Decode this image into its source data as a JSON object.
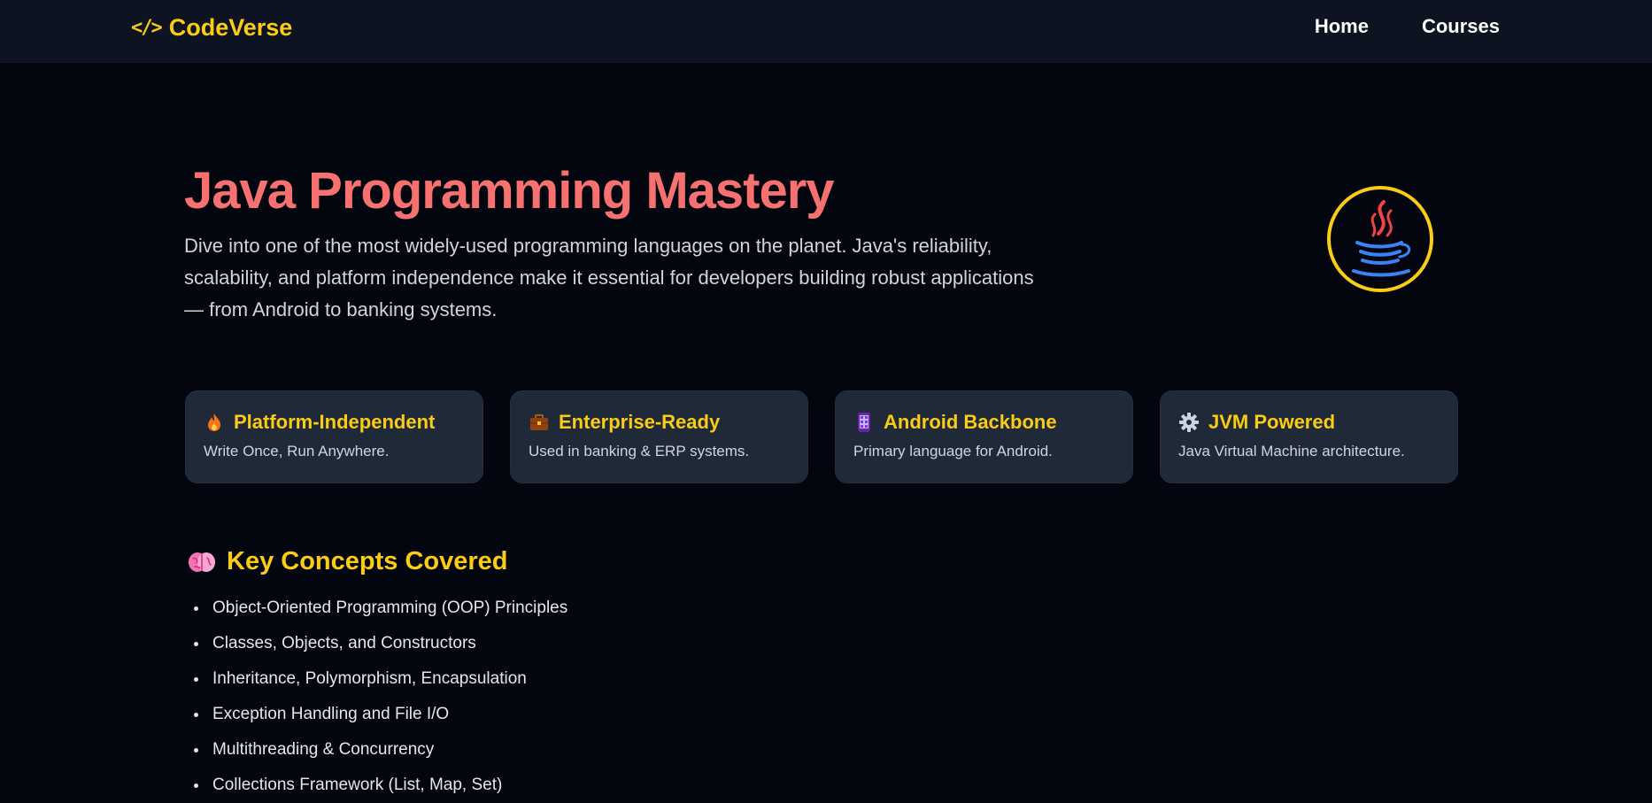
{
  "navbar": {
    "brand_icon": "</>",
    "brand_name": "CodeVerse",
    "links": [
      {
        "label": "Home"
      },
      {
        "label": "Courses"
      }
    ]
  },
  "hero": {
    "title": "Java Programming Mastery",
    "description": "Dive into one of the most widely-used programming languages on the planet. Java's reliability, scalability, and platform independence make it essential for developers building robust applications — from Android to banking systems.",
    "logo_icon": "java-coffee-cup-icon"
  },
  "features": [
    {
      "icon": "fire-icon",
      "title": "Platform-Independent",
      "description": "Write Once, Run Anywhere."
    },
    {
      "icon": "briefcase-icon",
      "title": "Enterprise-Ready",
      "description": "Used in banking & ERP systems."
    },
    {
      "icon": "phone-icon",
      "title": "Android Backbone",
      "description": "Primary language for Android."
    },
    {
      "icon": "gear-icon",
      "title": "JVM Powered",
      "description": "Java Virtual Machine architecture."
    }
  ],
  "concepts": {
    "icon": "brain-icon",
    "title": "Key Concepts Covered",
    "items": [
      "Object-Oriented Programming (OOP) Principles",
      "Classes, Objects, and Constructors",
      "Inheritance, Polymorphism, Encapsulation",
      "Exception Handling and File I/O",
      "Multithreading & Concurrency",
      "Collections Framework (List, Map, Set)"
    ]
  },
  "colors": {
    "accent_yellow": "#facc15",
    "title_red": "#f87171",
    "card_bg": "#1f2937",
    "page_bg": "#03060f",
    "navbar_bg": "#0d1321"
  }
}
